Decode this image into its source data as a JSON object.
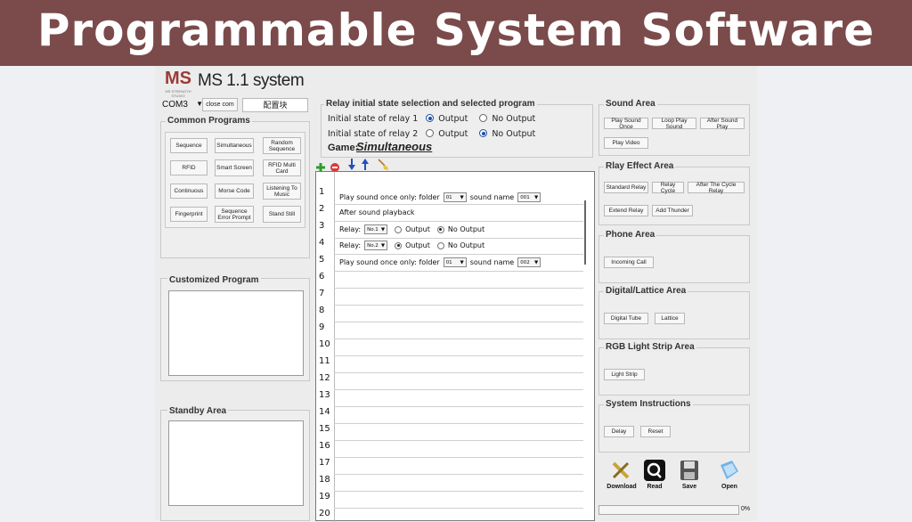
{
  "banner": {
    "title": "Programmable System Software"
  },
  "app": {
    "logo": "MS",
    "logo_sub": "MS STRENGTH STUDIO",
    "title": "MS 1.1 system"
  },
  "top": {
    "com_port": "COM3",
    "close_com": "close com",
    "config": "配置块"
  },
  "common_programs": {
    "title": "Common Programs",
    "buttons": [
      "Sequence",
      "Simultaneous",
      "Random Sequence",
      "RFID",
      "Smart Screen",
      "RFID Multi Card",
      "Continuous",
      "Morse Code",
      "Listening To Music",
      "Fingerprint",
      "Sequence Error Prompt",
      "Stand Still"
    ]
  },
  "customized_program": {
    "title": "Customized Program"
  },
  "standby_area": {
    "title": "Standby Area"
  },
  "relay_initial": {
    "title": "Relay initial state selection and selected program",
    "relay1_label": "Initial state of relay 1",
    "relay2_label": "Initial state of relay 2",
    "output": "Output",
    "no_output": "No Output",
    "game_label": "Game:",
    "game_value": "Simultaneous"
  },
  "program_rows": {
    "numbers": [
      "1",
      "2",
      "3",
      "4",
      "5",
      "6",
      "7",
      "8",
      "9",
      "10",
      "11",
      "12",
      "13",
      "14",
      "15",
      "16",
      "17",
      "18",
      "19",
      "20"
    ],
    "r1": {
      "text": "Play sound once only: folder",
      "folder": "01",
      "sound_label": "sound name",
      "sound": "001"
    },
    "r2": {
      "text": "After sound playback"
    },
    "r3": {
      "label": "Relay:",
      "relay": "No.1",
      "output": "Output",
      "no_output": "No Output"
    },
    "r4": {
      "label": "Relay:",
      "relay": "No.2",
      "output": "Output",
      "no_output": "No Output"
    },
    "r5": {
      "text": "Play sound once only: folder",
      "folder": "01",
      "sound_label": "sound name",
      "sound": "002"
    }
  },
  "sound_area": {
    "title": "Sound Area",
    "buttons": [
      "Play Sound Once",
      "Loop Play Sound",
      "After Sound Play",
      "Play Video"
    ]
  },
  "relay_effect": {
    "title": "Rlay Effect Area",
    "buttons": [
      "Standard Relay",
      "Relay Cycle",
      "After The Cycle Relay",
      "Extend Relay",
      "Add Thunder"
    ]
  },
  "phone_area": {
    "title": "Phone Area",
    "buttons": [
      "Incoming Call"
    ]
  },
  "digital_area": {
    "title": "Digital/Lattice Area",
    "buttons": [
      "Digital Tube",
      "Lattice"
    ]
  },
  "rgb_area": {
    "title": "RGB Light Strip Area",
    "buttons": [
      "Light Strip"
    ]
  },
  "system_area": {
    "title": "System Instructions",
    "buttons": [
      "Delay",
      "Reset"
    ]
  },
  "actions": {
    "download": "Download",
    "read": "Read",
    "save": "Save",
    "open": "Open"
  },
  "progress": {
    "label": "0%",
    "value": 0
  },
  "colors": {
    "banner": "#7a4b4a",
    "radio_selected": "#1a4fa8",
    "add_icon": "#2a9d2a",
    "remove_icon": "#d63b3b",
    "arrow_icon": "#2050c0"
  }
}
